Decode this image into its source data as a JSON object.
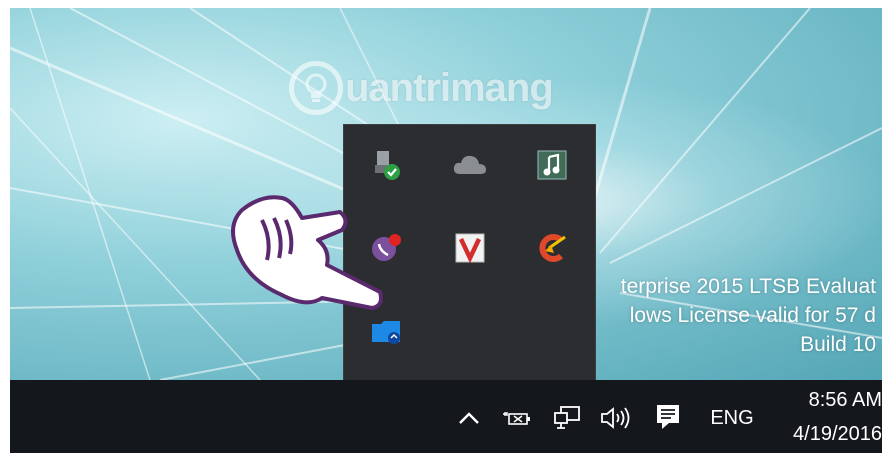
{
  "watermark": {
    "text": "uantrimang"
  },
  "desktop_info": {
    "line1": "terprise 2015 LTSB Evaluat",
    "line2": "lows License valid for 57 d",
    "line3": "Build 10"
  },
  "tray_flyout": {
    "icons": [
      "usb-safely-remove-icon",
      "onedrive-cloud-icon",
      "music-app-icon",
      "viber-icon",
      "antivirus-v-icon",
      "ccleaner-icon",
      "bluetooth-folder-icon"
    ]
  },
  "taskbar": {
    "show_hidden_icons": "^",
    "language": "ENG",
    "time": "8:56 AM",
    "date": "4/19/2016"
  }
}
